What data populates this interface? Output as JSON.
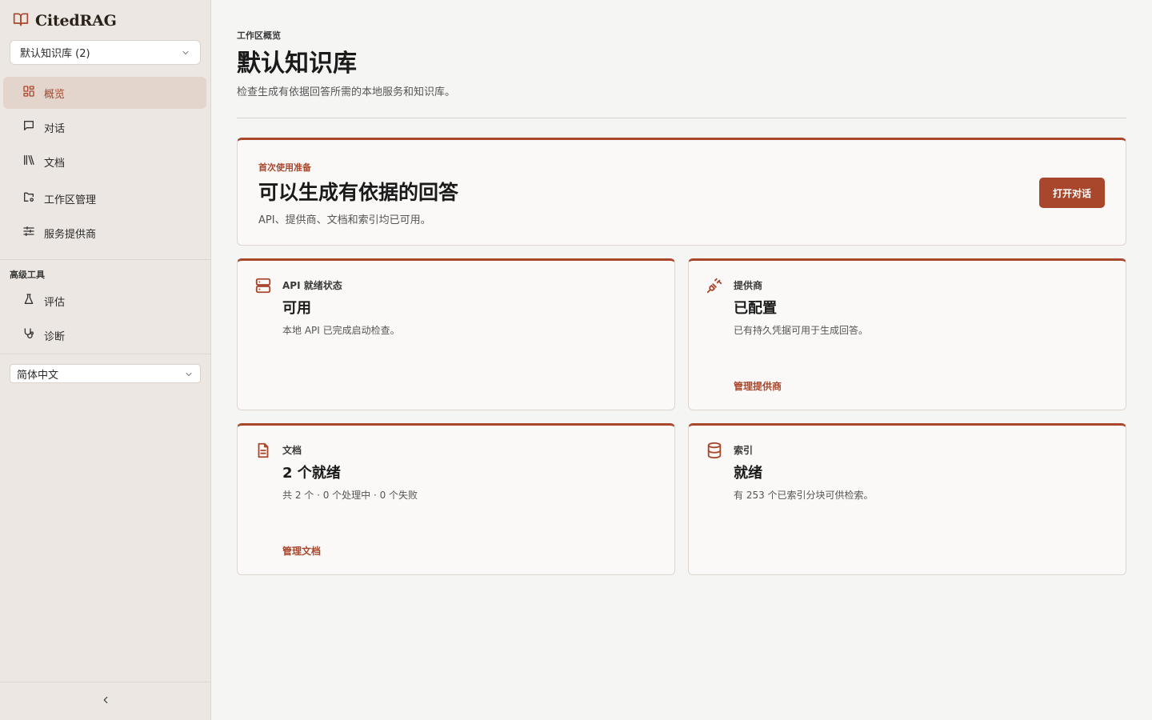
{
  "app": {
    "name": "CitedRAG"
  },
  "sidebar": {
    "workspace_select": {
      "value": "默认知识库 (2)"
    },
    "nav": [
      {
        "label": "概览",
        "icon": "grid-icon",
        "active": true
      },
      {
        "label": "对话",
        "icon": "chat-icon"
      },
      {
        "label": "文档",
        "icon": "library-icon"
      },
      {
        "label": "工作区管理",
        "icon": "folder-settings-icon"
      },
      {
        "label": "服务提供商",
        "icon": "sliders-icon"
      }
    ],
    "advanced_label": "高级工具",
    "advanced": [
      {
        "label": "评估",
        "icon": "flask-icon"
      },
      {
        "label": "诊断",
        "icon": "stethoscope-icon"
      }
    ],
    "language_select": {
      "value": "简体中文"
    }
  },
  "header": {
    "eyebrow": "工作区概览",
    "title": "默认知识库",
    "subtitle": "检查生成有依据回答所需的本地服务和知识库。"
  },
  "hero": {
    "kicker": "首次使用准备",
    "title": "可以生成有依据的回答",
    "description": "API、提供商、文档和索引均已可用。",
    "button": "打开对话"
  },
  "tiles": [
    {
      "icon": "server-icon",
      "label": "API 就绪状态",
      "value": "可用",
      "detail": "本地 API 已完成启动检查。",
      "link": ""
    },
    {
      "icon": "plug-icon",
      "label": "提供商",
      "value": "已配置",
      "detail": "已有持久凭据可用于生成回答。",
      "link": "管理提供商"
    },
    {
      "icon": "document-icon",
      "label": "文档",
      "value": "2 个就绪",
      "detail": "共 2 个 · 0 个处理中 · 0 个失败",
      "link": "管理文档"
    },
    {
      "icon": "database-icon",
      "label": "索引",
      "value": "就绪",
      "detail": "有 253 个已索引分块可供检索。",
      "link": ""
    }
  ],
  "colors": {
    "accent": "#a8472c",
    "sidebar_bg": "#ece7e2",
    "page_bg": "#f5f5f4",
    "card_bg": "#faf9f7"
  }
}
